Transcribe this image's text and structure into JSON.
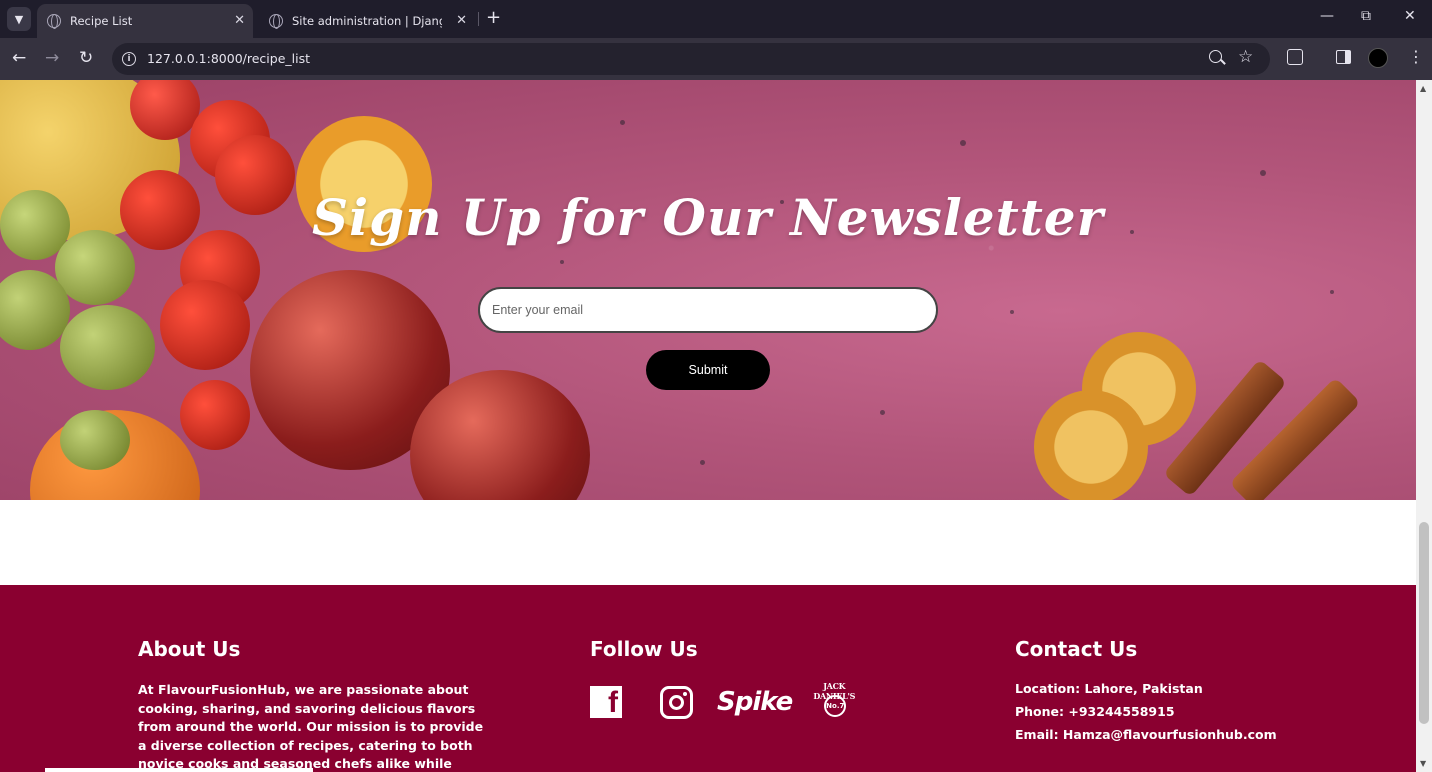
{
  "browser": {
    "tabs": [
      {
        "title": "Recipe List",
        "active": true
      },
      {
        "title": "Site administration | Django site admin",
        "active": false
      }
    ],
    "new_tab_label": "+",
    "tab_menu_icon": "chevron-down-icon",
    "window_controls": {
      "minimize": "—",
      "restore": "⧉",
      "close": "✕"
    },
    "nav": {
      "back": "←",
      "forward": "→",
      "reload": "↻"
    },
    "url": "127.0.0.1:8000/recipe_list",
    "star": "☆",
    "kebab": "⋮"
  },
  "newsletter": {
    "title": "Sign Up for Our Newsletter",
    "email_placeholder": "Enter your email",
    "email_value": "",
    "submit_label": "Submit"
  },
  "footer": {
    "background": "#8a0030",
    "about": {
      "heading": "About Us",
      "text": "At FlavourFusionHub, we are passionate about cooking, sharing, and savoring delicious flavors from around the world. Our mission is to provide a diverse collection of recipes, catering to both novice cooks and seasoned chefs alike while celebrating the joy of creating."
    },
    "follow": {
      "heading": "Follow Us",
      "icons": [
        "facebook-icon",
        "instagram-icon",
        "spike-icon",
        "jack-daniels-icon"
      ],
      "facebook_glyph": "f",
      "spike_text": "Spike",
      "jd_text": "JACK DANIEL'S",
      "jd_badge": "No.7"
    },
    "contact": {
      "heading": "Contact Us",
      "location": "Location: Lahore, Pakistan",
      "phone": "Phone: +93244558915",
      "email": "Email: Hamza@flavourfusionhub.com"
    }
  },
  "scrollbar": {
    "up": "▲",
    "down": "▼"
  }
}
